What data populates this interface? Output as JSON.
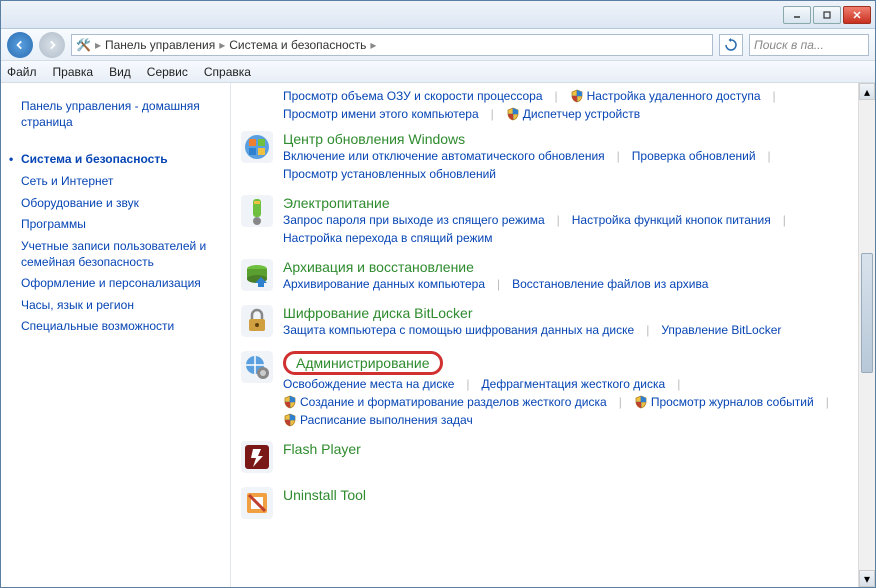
{
  "titlebar": {
    "minimize": "_",
    "maximize": "☐",
    "close": "✕"
  },
  "breadcrumb": {
    "root": "Панель управления",
    "current": "Система и безопасность"
  },
  "search": {
    "placeholder": "Поиск в па..."
  },
  "menu": {
    "file": "Файл",
    "edit": "Правка",
    "view": "Вид",
    "service": "Сервис",
    "help": "Справка"
  },
  "sidebar": {
    "home": "Панель управления - домашняя страница",
    "items": [
      "Система и безопасность",
      "Сеть и Интернет",
      "Оборудование и звук",
      "Программы",
      "Учетные записи пользователей и семейная безопасность",
      "Оформление и персонализация",
      "Часы, язык и регион",
      "Специальные возможности"
    ]
  },
  "top_links": [
    {
      "text": "Просмотр объема ОЗУ и скорости процессора",
      "shield": false
    },
    {
      "text": "Настройка удаленного доступа",
      "shield": true
    },
    {
      "text": "Просмотр имени этого компьютера",
      "shield": false
    },
    {
      "text": "Диспетчер устройств",
      "shield": true
    }
  ],
  "sections": [
    {
      "title": "Центр обновления Windows",
      "icon": "windows-update-icon",
      "links": [
        {
          "text": "Включение или отключение автоматического обновления",
          "shield": false
        },
        {
          "text": "Проверка обновлений",
          "shield": false
        },
        {
          "text": "Просмотр установленных обновлений",
          "shield": false
        }
      ]
    },
    {
      "title": "Электропитание",
      "icon": "power-icon",
      "links": [
        {
          "text": "Запрос пароля при выходе из спящего режима",
          "shield": false
        },
        {
          "text": "Настройка функций кнопок питания",
          "shield": false
        },
        {
          "text": "Настройка перехода в спящий режим",
          "shield": false
        }
      ]
    },
    {
      "title": "Архивация и восстановление",
      "icon": "backup-icon",
      "links": [
        {
          "text": "Архивирование данных компьютера",
          "shield": false
        },
        {
          "text": "Восстановление файлов из архива",
          "shield": false
        }
      ]
    },
    {
      "title": "Шифрование диска BitLocker",
      "icon": "bitlocker-icon",
      "links": [
        {
          "text": "Защита компьютера с помощью шифрования данных на диске",
          "shield": false
        },
        {
          "text": "Управление BitLocker",
          "shield": false
        }
      ]
    },
    {
      "title": "Администрирование",
      "icon": "admin-icon",
      "highlighted": true,
      "links": [
        {
          "text": "Освобождение места на диске",
          "shield": false
        },
        {
          "text": "Дефрагментация жесткого диска",
          "shield": false
        },
        {
          "text": "Создание и форматирование разделов жесткого диска",
          "shield": true
        },
        {
          "text": "Просмотр журналов событий",
          "shield": true
        },
        {
          "text": "Расписание выполнения задач",
          "shield": true
        }
      ]
    },
    {
      "title": "Flash Player",
      "icon": "flash-icon",
      "links": []
    },
    {
      "title": "Uninstall Tool",
      "icon": "uninstall-icon",
      "links": []
    }
  ]
}
